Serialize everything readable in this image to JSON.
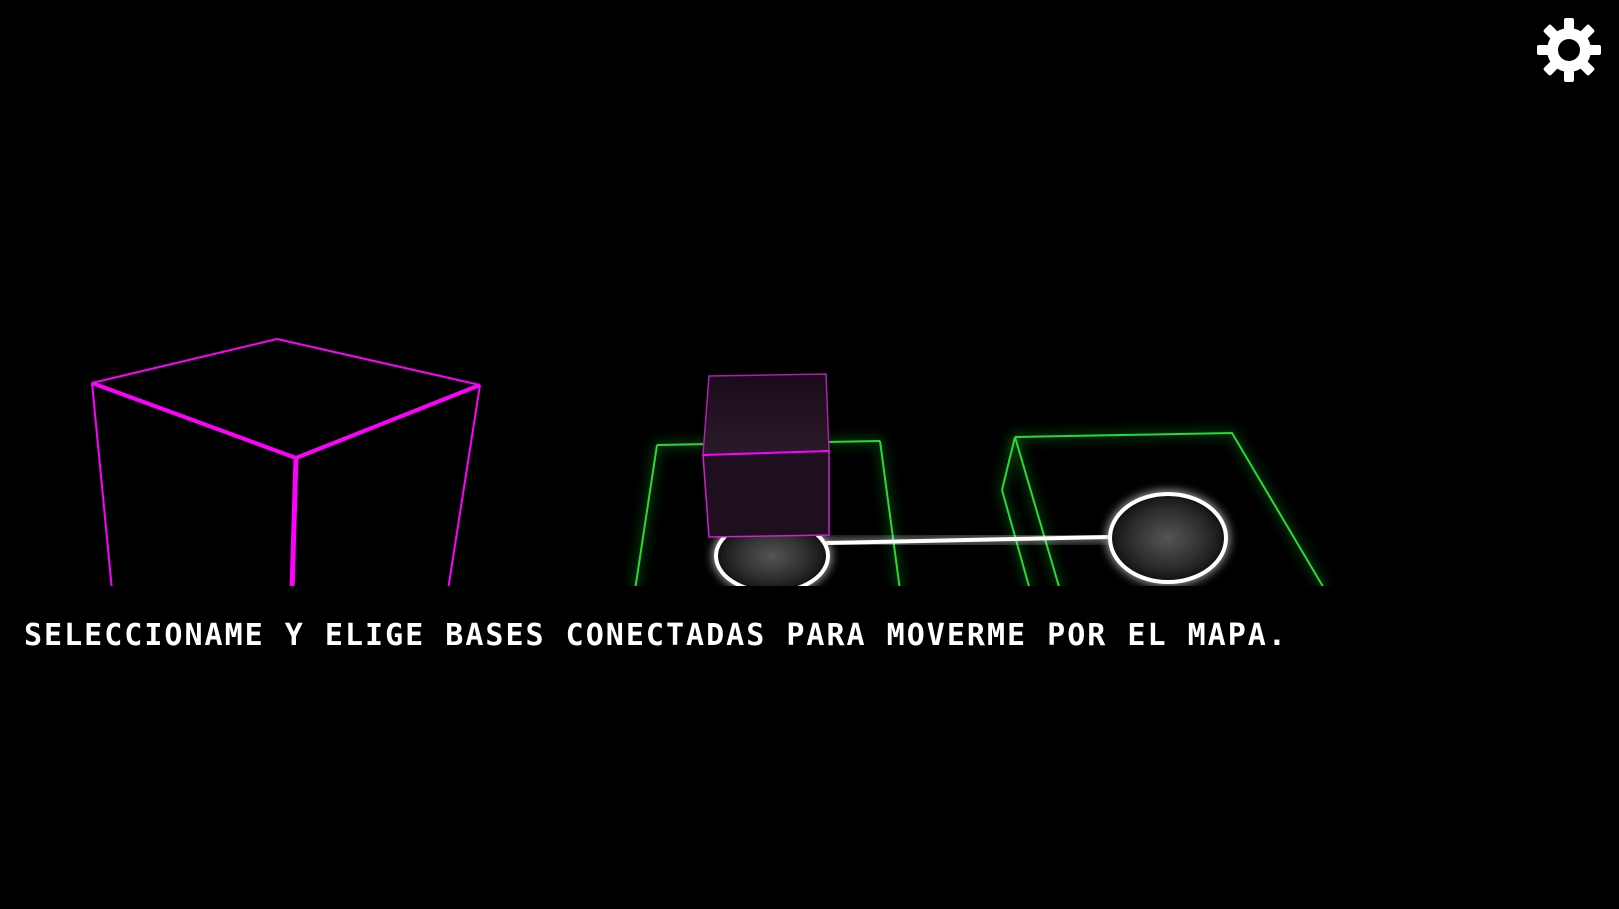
{
  "tutorial": {
    "message": "SELECCIONAME Y ELIGE BASES CONECTADAS PARA MOVERME POR EL MAPA."
  },
  "settings": {
    "icon": "gear-icon",
    "color": "#ffffff"
  },
  "colors": {
    "background": "#000000",
    "player_cube": "#ff00ff",
    "base_outline": "#22dd33",
    "connection_node": "#ffffff"
  }
}
